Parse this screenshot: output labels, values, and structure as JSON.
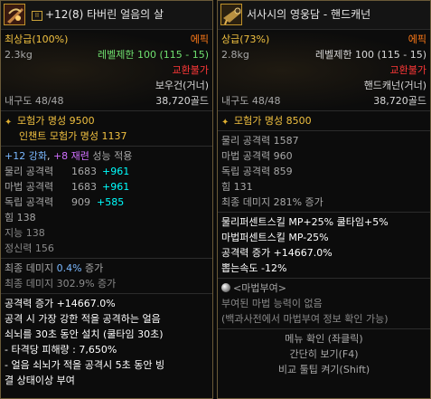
{
  "left": {
    "title": "+12(8) 타버린 얼음의 살",
    "lock_mark": "II",
    "grade": "최상급(100%)",
    "rarity": "에픽",
    "weight": "2.3kg",
    "level_limit": "레벨제한 100 (115 - 15)",
    "trade": "교환불가",
    "type": "보우건(거너)",
    "durability": "내구도 48/48",
    "price": "38,720골드",
    "fame": "모험가 명성 9500",
    "enchant_fame": "인챈트 모험가 명성 1137",
    "enhance": {
      "a": "+12 강화",
      "b": ", ",
      "c": "+8 재련",
      "d": " 성능 적용"
    },
    "stats": [
      {
        "label": "물리 공격력",
        "value": "1683",
        "bonus": "+961"
      },
      {
        "label": "마법 공격력",
        "value": "1683",
        "bonus": "+961"
      },
      {
        "label": "독립 공격력",
        "value": "909",
        "bonus": "+585"
      }
    ],
    "plain_stats": [
      "힘 138",
      "지능 138",
      "정신력 156"
    ],
    "final_damage_1": {
      "label": "최종 데미지 ",
      "value": "0.4%",
      "suffix": " 증가"
    },
    "final_damage_2": "최종 데미지 302.9% 증가",
    "option_lines": [
      "공격력 증가 +14667.0%",
      "공격 시 가장 강한 적을 공격하는 얼음",
      "쇠뇌를 30초 동안 설치 (쿨타임 30초)",
      "- 타격당 피해량 : 7,650%",
      "- 얼음 쇠뇌가 적을 공격시 5초 동안 빙",
      "결 상태이상 부여"
    ]
  },
  "right": {
    "title": "서사시의 영웅담 - 핸드캐넌",
    "grade": "상급(73%)",
    "rarity": "에픽",
    "weight": "2.8kg",
    "level_limit": "레벨제한 100 (115 - 15)",
    "trade": "교환불가",
    "type": "핸드캐넌(거너)",
    "durability": "내구도 48/48",
    "price": "38,720골드",
    "fame": "모험가 명성 8500",
    "stats": [
      "물리 공격력 1587",
      "마법 공격력 960",
      "독립 공격력 859",
      "힘 131",
      "최종 데미지 281% 증가"
    ],
    "option_lines": [
      "물리퍼센트스킬 MP+25% 쿨타임+5%",
      "마법퍼센트스킬 MP-25%",
      "공격력 증가 +14667.0%",
      "뽑는속도 -12%"
    ],
    "magic_seal_title": "<마법부여>",
    "magic_seal_desc": "부여된 마법 능력이 없음",
    "magic_seal_hint": "(백과사전에서 마법부여 정보 확인 가능)",
    "menu": [
      "메뉴 확인 (좌클릭)",
      "간단히 보기(F4)",
      "비교 툴팁 켜기(Shift)"
    ]
  },
  "colors": {
    "gold": "#f0c040",
    "epic": "#ff7a18",
    "untradeable": "#ff3838",
    "level": "#6fe06f",
    "enhance": "#7ab8ff",
    "refine": "#d070ff",
    "bonus": "#00ffff"
  },
  "icons": [
    "lock-icon",
    "bowgun-item-icon",
    "handcannon-item-icon",
    "medal-icon",
    "magic-orb-icon"
  ]
}
